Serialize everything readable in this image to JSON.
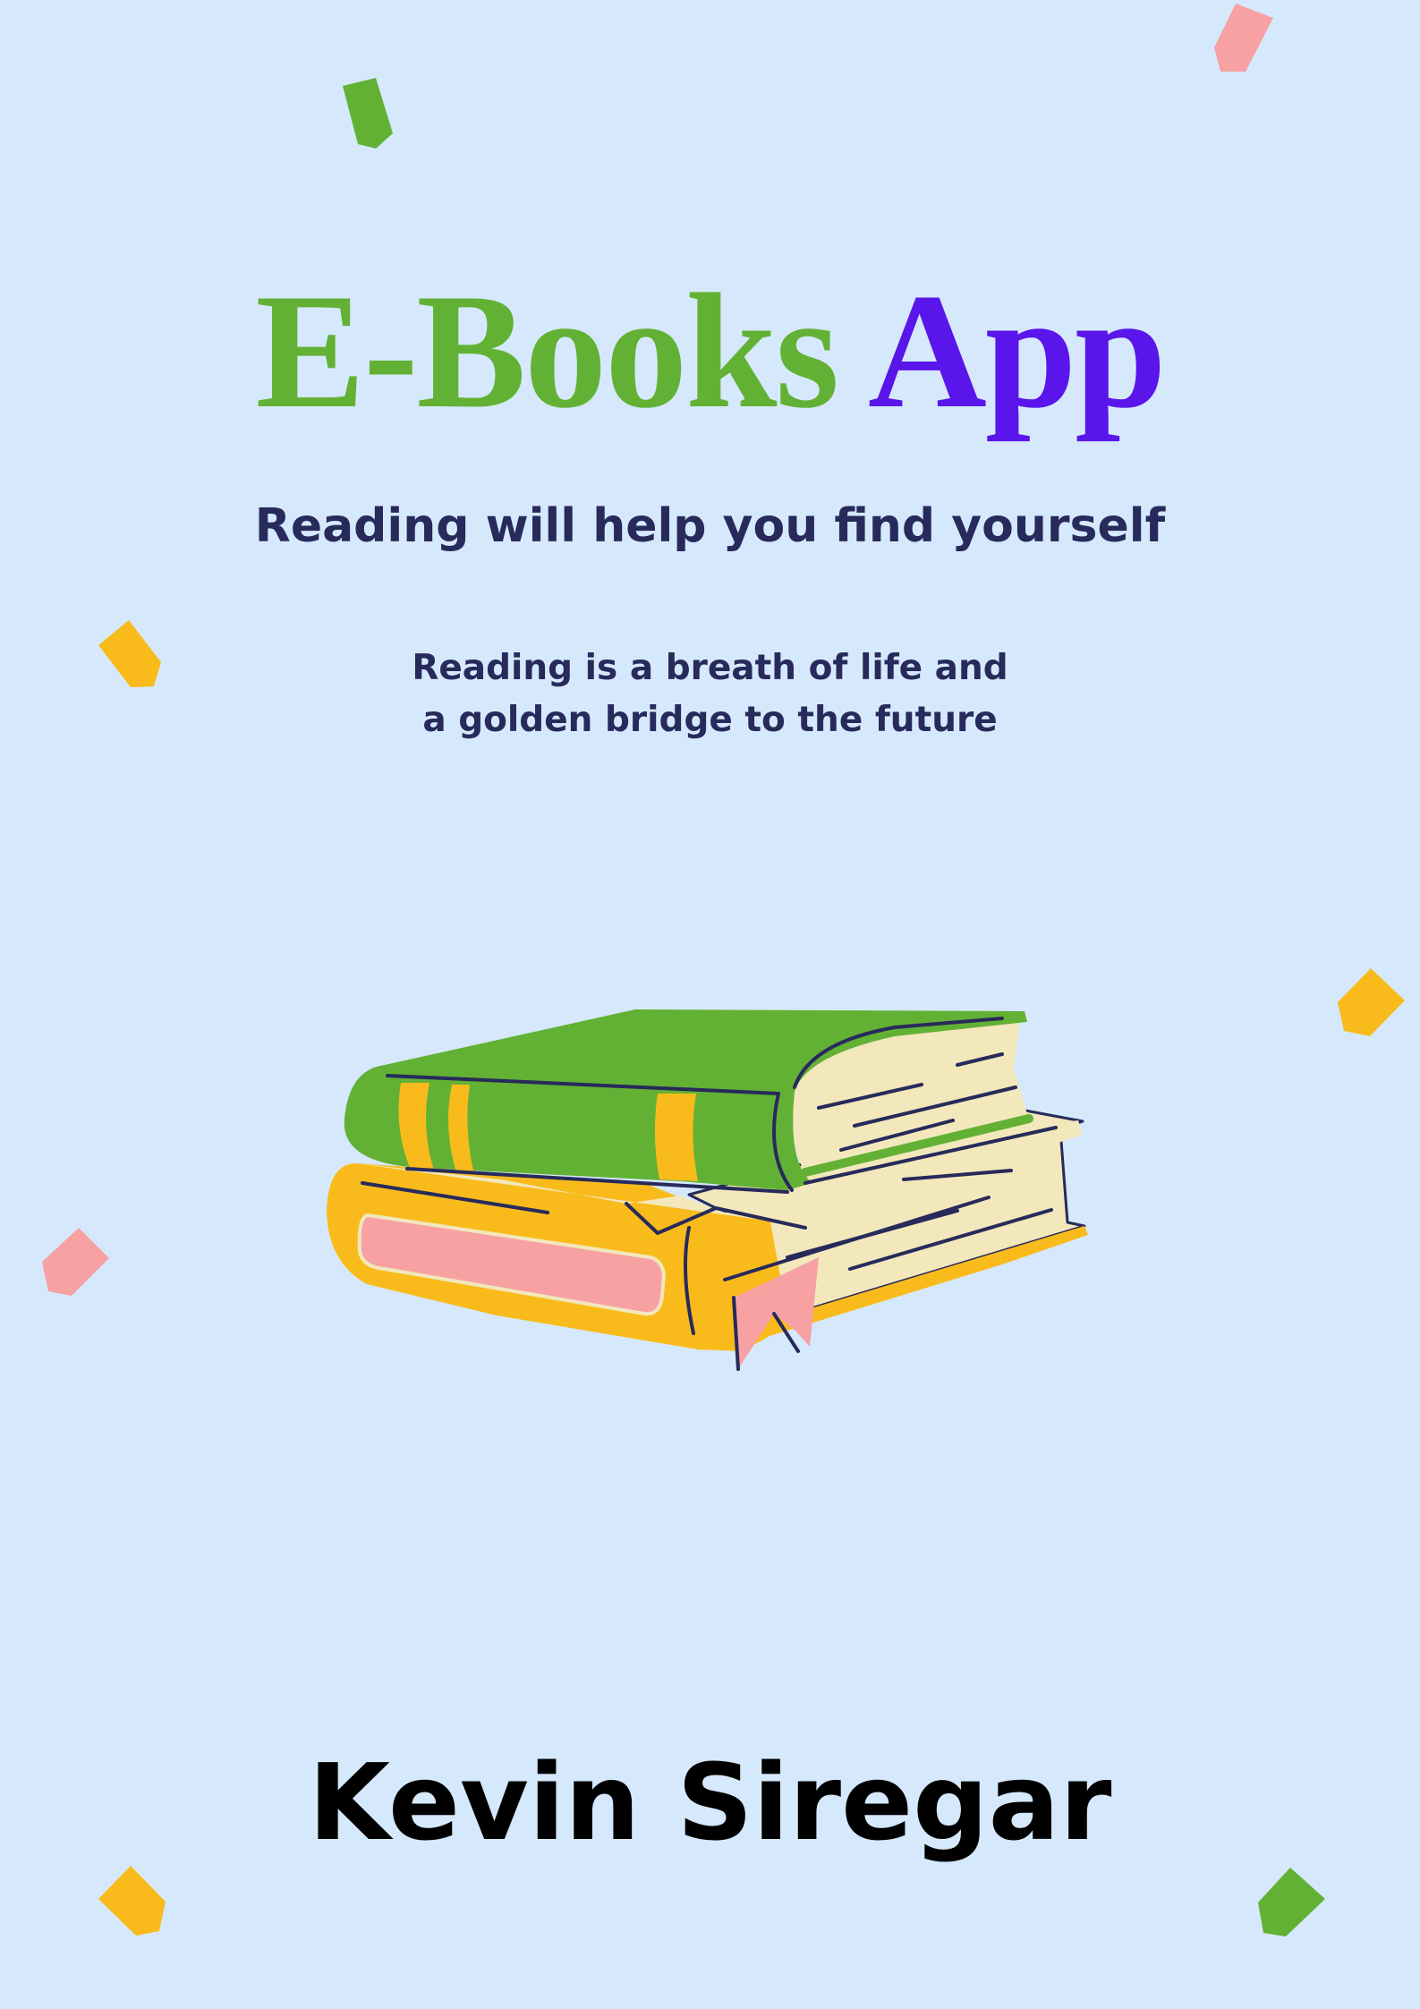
{
  "cover": {
    "title_part1": "E-Books",
    "title_part2": "App",
    "subtitle": "Reading will help you find yourself",
    "tagline_line1": "Reading is a breath of life and",
    "tagline_line2": "a golden bridge to the future",
    "author": "Kevin Siregar"
  },
  "colors": {
    "background": "#d6e9fc",
    "green": "#63b134",
    "purple": "#5a15ea",
    "navy": "#272a5a",
    "yellow": "#f9bb1c",
    "pink": "#f7a1a3",
    "cream": "#f2e8bc"
  },
  "illustration": {
    "name": "stacked-books-illustration"
  }
}
